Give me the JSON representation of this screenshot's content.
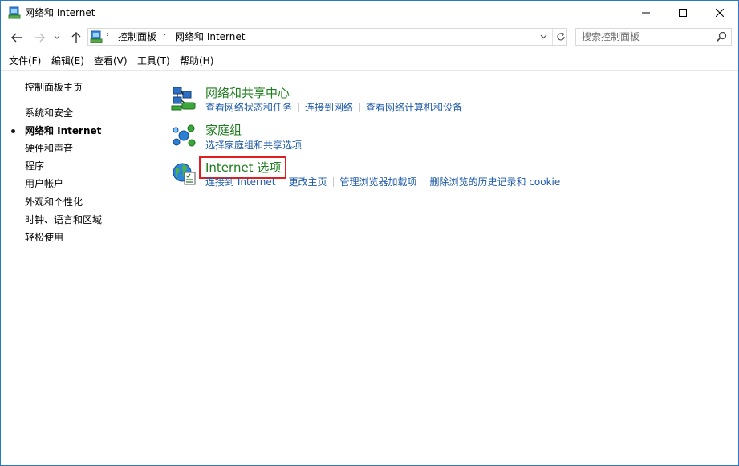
{
  "window": {
    "title": "网络和 Internet",
    "controls": {
      "minimize": "minimize",
      "maximize": "maximize",
      "close": "close"
    }
  },
  "address": {
    "crumbs": [
      "控制面板",
      "网络和 Internet"
    ]
  },
  "search": {
    "placeholder": "搜索控制面板"
  },
  "menu": [
    "文件(F)",
    "编辑(E)",
    "查看(V)",
    "工具(T)",
    "帮助(H)"
  ],
  "sidebar": {
    "home": "控制面板主页",
    "items": [
      "系统和安全",
      "网络和 Internet",
      "硬件和声音",
      "程序",
      "用户帐户",
      "外观和个性化",
      "时钟、语言和区域",
      "轻松使用"
    ],
    "current_index": 1
  },
  "categories": [
    {
      "title": "网络和共享中心",
      "icon": "network-sharing-icon",
      "links": [
        "查看网络状态和任务",
        "连接到网络",
        "查看网络计算机和设备"
      ]
    },
    {
      "title": "家庭组",
      "icon": "homegroup-icon",
      "links": [
        "选择家庭组和共享选项"
      ]
    },
    {
      "title": "Internet 选项",
      "icon": "internet-options-icon",
      "links": [
        "连接到 Internet",
        "更改主页",
        "管理浏览器加载项",
        "删除浏览的历史记录和 cookie"
      ]
    }
  ],
  "colors": {
    "title_green": "#1e7d1e",
    "link_blue": "#1e5aa8",
    "highlight_red": "#e02020"
  }
}
